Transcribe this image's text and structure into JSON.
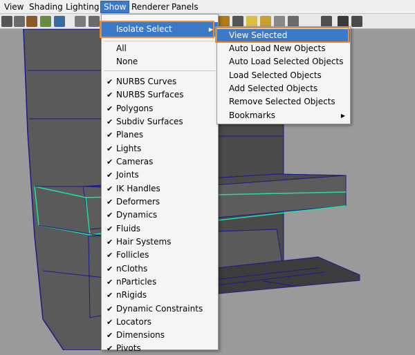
{
  "menubar": [
    "View",
    "Shading",
    "Lighting",
    "Show",
    "Renderer",
    "Panels"
  ],
  "show_menu": {
    "isolate_select": "Isolate Select",
    "all": "All",
    "none": "None",
    "items": [
      "NURBS Curves",
      "NURBS Surfaces",
      "Polygons",
      "Subdiv Surfaces",
      "Planes",
      "Lights",
      "Cameras",
      "Joints",
      "IK Handles",
      "Deformers",
      "Dynamics",
      "Fluids",
      "Hair Systems",
      "Follicles",
      "nCloths",
      "nParticles",
      "nRigids",
      "Dynamic Constraints",
      "Locators",
      "Dimensions",
      "Pivots"
    ]
  },
  "isolate_submenu": {
    "items": [
      "View Selected",
      "Auto Load New Objects",
      "Auto Load Selected Objects",
      "Load Selected Objects",
      "Add Selected Objects",
      "Remove Selected Objects",
      "Bookmarks"
    ]
  },
  "colors": {
    "accent": "#3d79c9",
    "highlight_outline": "#ee8a2a",
    "mesh_wire": "#1a1a8c",
    "selected_edge": "#22e0a0"
  }
}
